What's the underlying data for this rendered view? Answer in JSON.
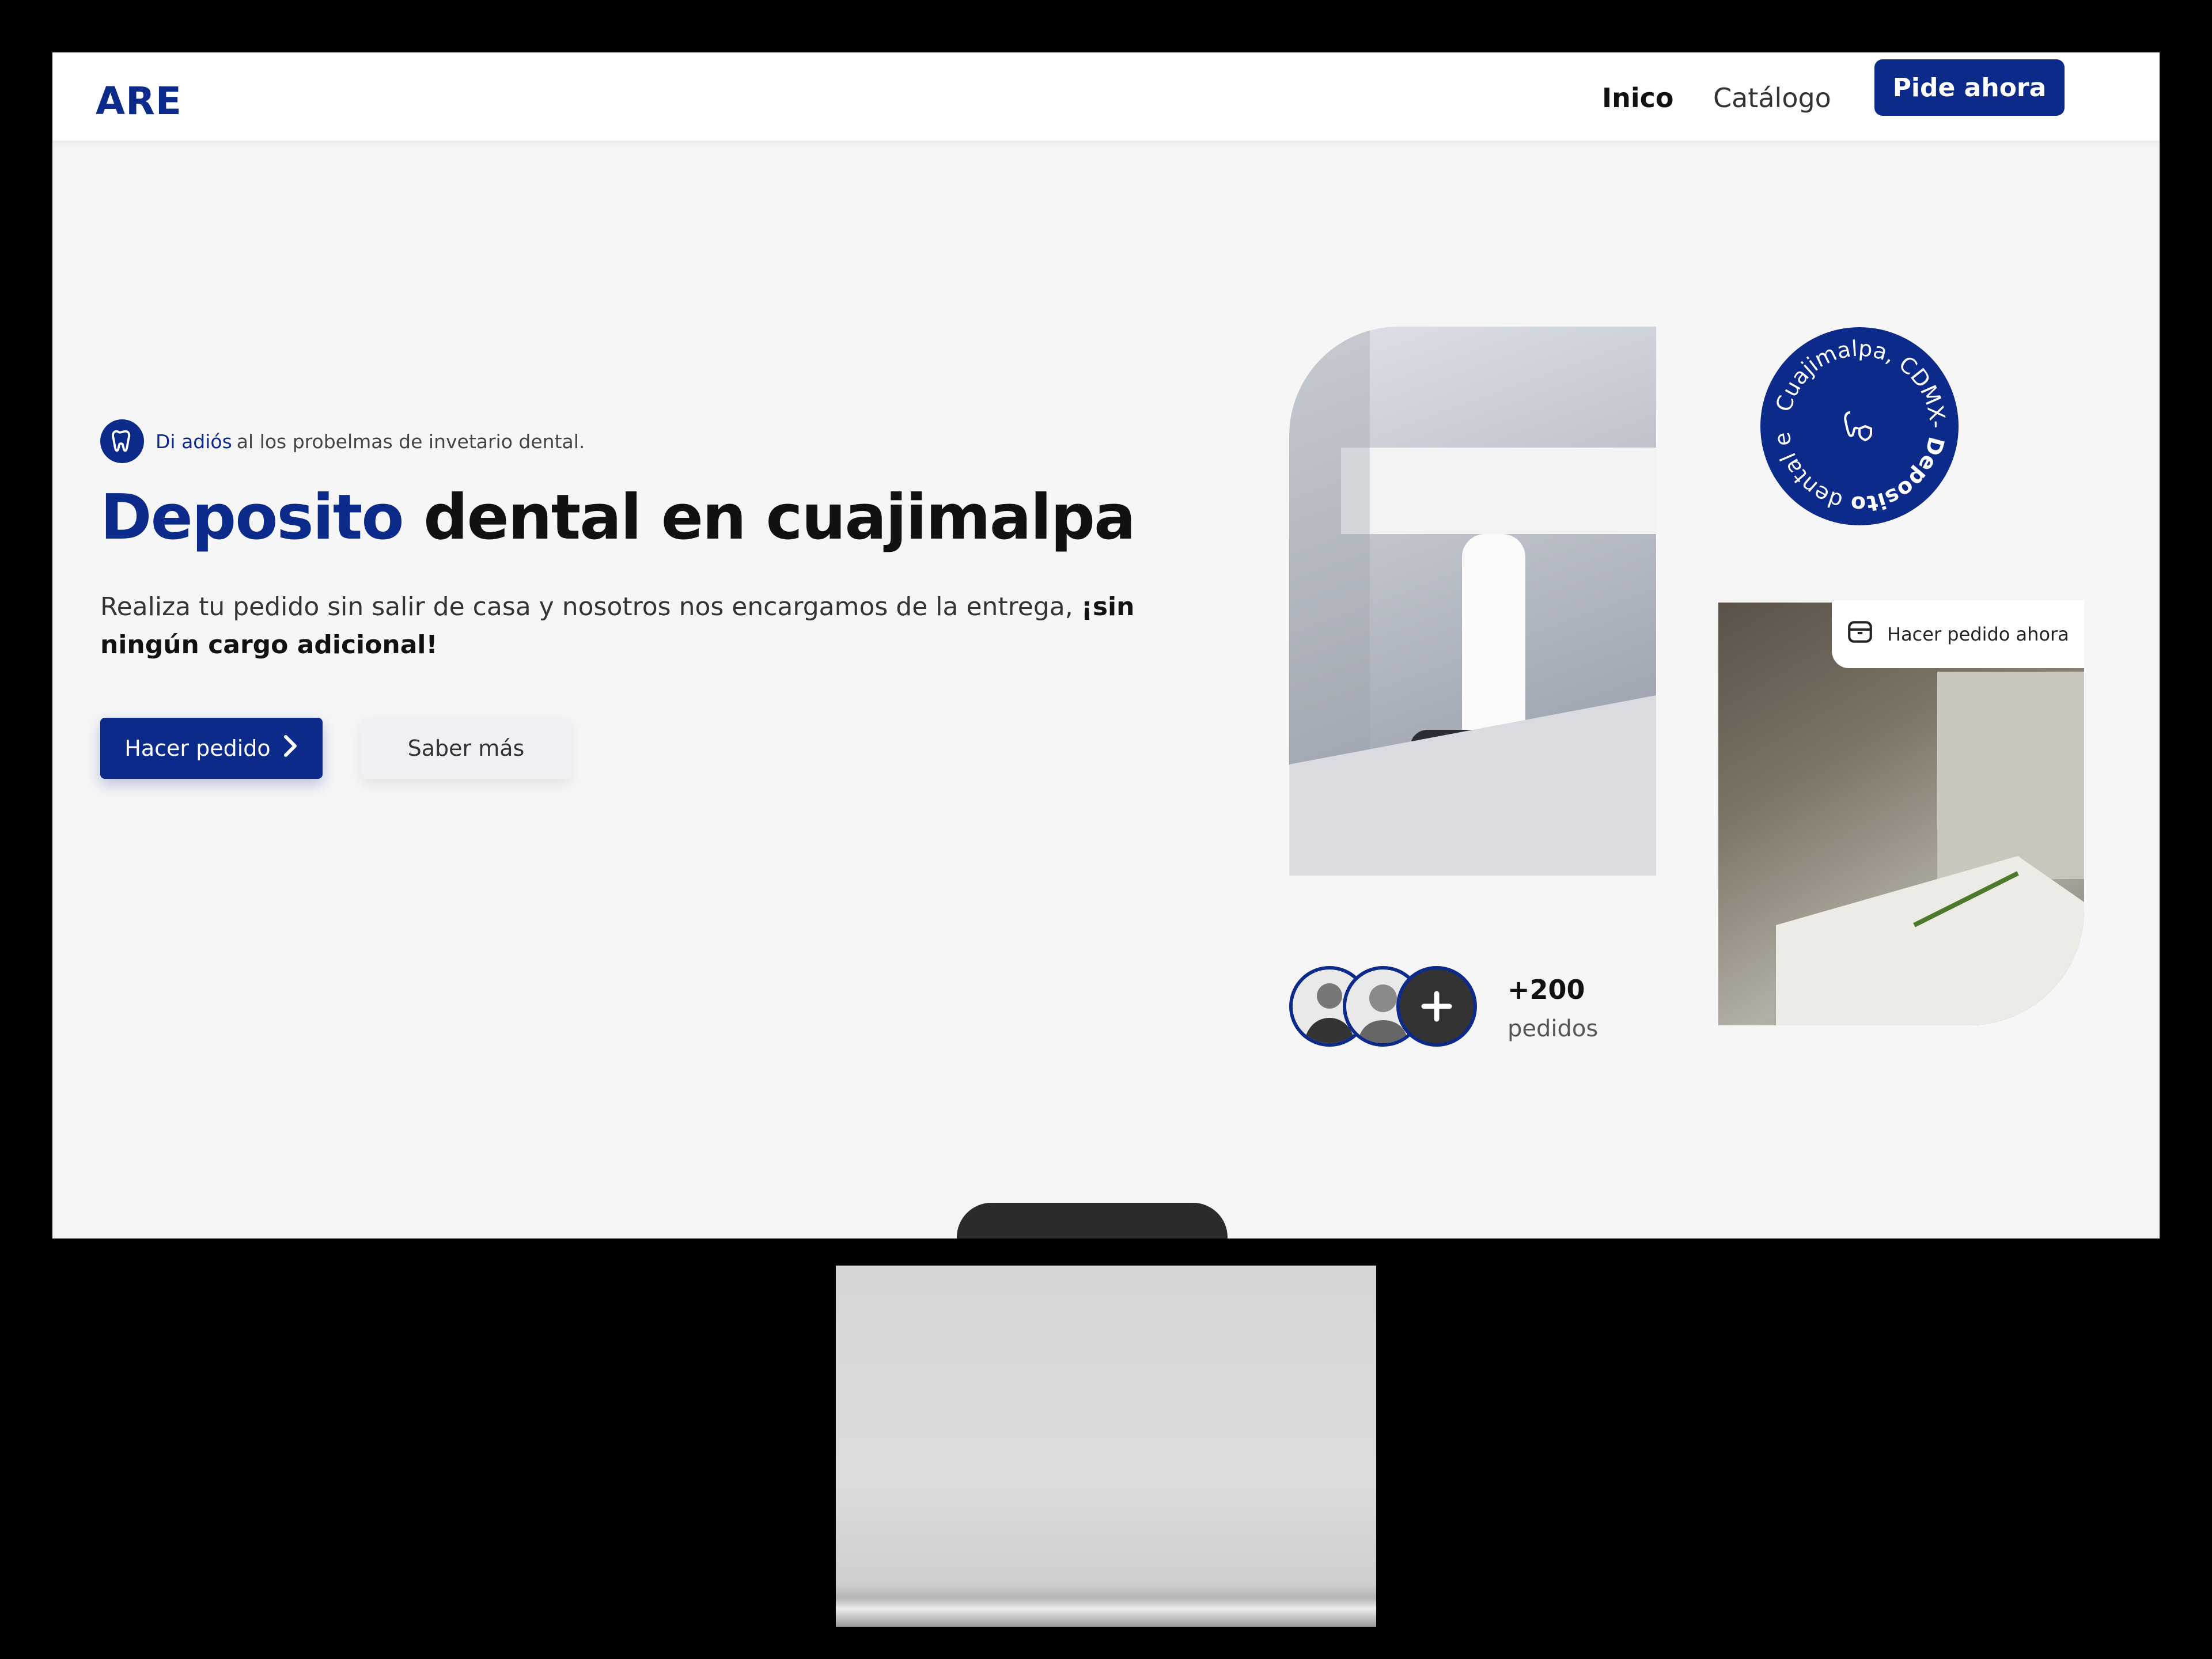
{
  "nav": {
    "logo": "ARE",
    "links": [
      {
        "label": "Inico",
        "active": true
      },
      {
        "label": "Catálogo",
        "active": false
      }
    ],
    "cta": "Pide ahora"
  },
  "hero": {
    "tagline_strong": "Di adiós",
    "tagline_rest": "al los probelmas de invetario dental.",
    "headline_accent": "Deposito",
    "headline_rest": "dental en cuajimalpa",
    "subtitle": "Realiza tu pedido sin salir de casa y nosotros nos encargamos de la entrega,",
    "subtitle_bold": "¡sin ningún cargo adicional!",
    "primary_button": "Hacer pedido",
    "secondary_button": "Saber más"
  },
  "badge": {
    "ring_text": "Cuajimalpa, CDMX-",
    "ring_bold": "Deposito",
    "ring_tail": "dental en",
    "icon": "tooth-shield-icon"
  },
  "order_tag": {
    "label": "Hacer pedido ahora",
    "icon": "box-icon"
  },
  "stats": {
    "count": "+200",
    "label": "pedidos"
  },
  "colors": {
    "brand": "#0b2a8a",
    "background": "#f6f6f7"
  }
}
